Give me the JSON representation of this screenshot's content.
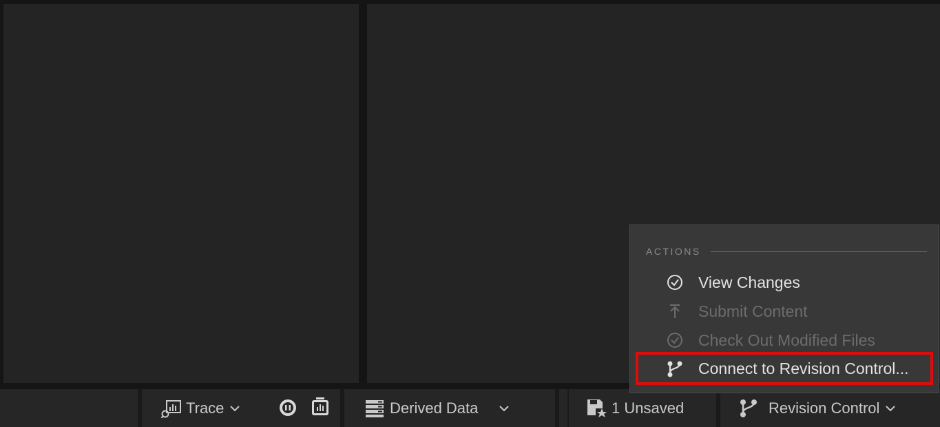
{
  "menu": {
    "section_header": "ACTIONS",
    "items": [
      {
        "label": "View Changes",
        "icon": "check-circle-icon",
        "enabled": true
      },
      {
        "label": "Submit Content",
        "icon": "upload-arrow-icon",
        "enabled": false
      },
      {
        "label": "Check Out Modified Files",
        "icon": "check-circle-icon",
        "enabled": false
      },
      {
        "label": "Connect to Revision Control...",
        "icon": "branch-icon",
        "enabled": true,
        "highlighted": true
      }
    ]
  },
  "status_bar": {
    "trace_label": "Trace",
    "derived_data_label": "Derived Data",
    "unsaved_label": "1 Unsaved",
    "revision_control_label": "Revision Control"
  },
  "colors": {
    "background": "#151515",
    "panel": "#242424",
    "menu_background": "#383838",
    "highlight_border": "#e00c0c",
    "enabled_text": "#e2e2e2",
    "disabled_text": "#6c6c6c"
  }
}
